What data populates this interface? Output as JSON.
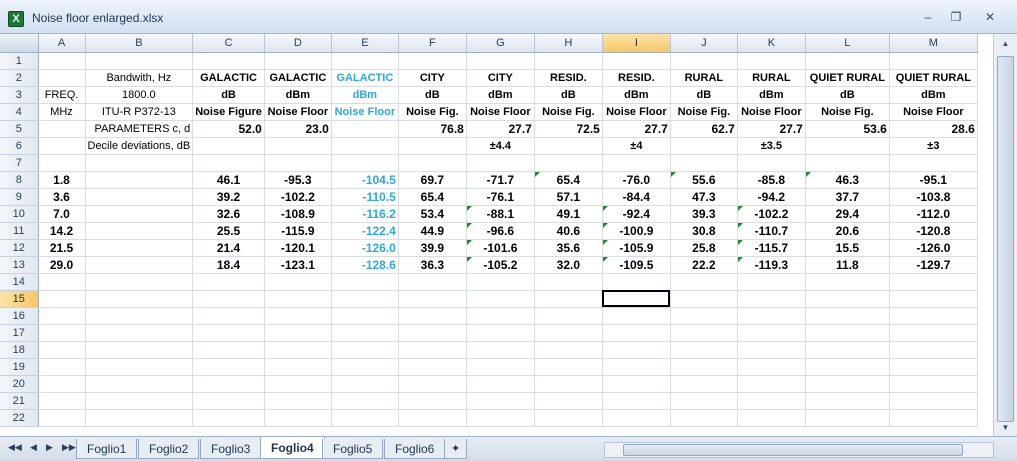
{
  "window": {
    "title": "Noise floor enlarged.xlsx"
  },
  "columns": [
    "A",
    "B",
    "C",
    "D",
    "E",
    "F",
    "G",
    "H",
    "I",
    "J",
    "K",
    "L",
    "M"
  ],
  "selected_column": "I",
  "selected_row": "15",
  "active_cell": "I15",
  "rows": [
    {
      "n": "1",
      "cells": {}
    },
    {
      "n": "2",
      "cells": {
        "B": "Bandwith, Hz",
        "C": "GALACTIC",
        "D": "GALACTIC",
        "E": "GALACTIC",
        "F": "CITY",
        "G": "CITY",
        "H": "RESID.",
        "I": "RESID.",
        "J": "RURAL",
        "K": "RURAL",
        "L": "QUIET RURAL",
        "M": "QUIET RURAL"
      }
    },
    {
      "n": "3",
      "cells": {
        "A": "FREQ.",
        "B": "1800.0",
        "C": "dB",
        "D": "dBm",
        "E": "dBm",
        "F": "dB",
        "G": "dBm",
        "H": "dB",
        "I": "dBm",
        "J": "dB",
        "K": "dBm",
        "L": "dB",
        "M": "dBm"
      }
    },
    {
      "n": "4",
      "cells": {
        "A": "MHz",
        "B": "ITU-R P372-13",
        "C": "Noise Figure",
        "D": "Noise Floor",
        "E": "Noise Floor",
        "F": "Noise Fig.",
        "G": "Noise Floor",
        "H": "Noise Fig.",
        "I": "Noise Floor",
        "J": "Noise Fig.",
        "K": "Noise Floor",
        "L": "Noise Fig.",
        "M": "Noise Floor"
      }
    },
    {
      "n": "5",
      "cells": {
        "B": "PARAMETERS c, d",
        "C": "52.0",
        "D": "23.0",
        "F": "76.8",
        "G": "27.7",
        "H": "72.5",
        "I": "27.7",
        "J": "62.7",
        "K": "27.7",
        "L": "53.6",
        "M": "28.6"
      }
    },
    {
      "n": "6",
      "cells": {
        "B": "Decile deviations, dB",
        "G": "±4.4",
        "I": "±4",
        "K": "±3.5",
        "M": "±3"
      }
    },
    {
      "n": "7",
      "cells": {}
    },
    {
      "n": "8",
      "cells": {
        "A": "1.8",
        "C": "46.1",
        "D": "-95.3",
        "E": "-104.5",
        "F": "69.7",
        "G": "-71.7",
        "H": "65.4",
        "I": "-76.0",
        "J": "55.6",
        "K": "-85.8",
        "L": "46.3",
        "M": "-95.1"
      }
    },
    {
      "n": "9",
      "cells": {
        "A": "3.6",
        "C": "39.2",
        "D": "-102.2",
        "E": "-110.5",
        "F": "65.4",
        "G": "-76.1",
        "H": "57.1",
        "I": "-84.4",
        "J": "47.3",
        "K": "-94.2",
        "L": "37.7",
        "M": "-103.8"
      }
    },
    {
      "n": "10",
      "cells": {
        "A": "7.0",
        "C": "32.6",
        "D": "-108.9",
        "E": "-116.2",
        "F": "53.4",
        "G": "-88.1",
        "H": "49.1",
        "I": "-92.4",
        "J": "39.3",
        "K": "-102.2",
        "L": "29.4",
        "M": "-112.0"
      }
    },
    {
      "n": "11",
      "cells": {
        "A": "14.2",
        "C": "25.5",
        "D": "-115.9",
        "E": "-122.4",
        "F": "44.9",
        "G": "-96.6",
        "H": "40.6",
        "I": "-100.9",
        "J": "30.8",
        "K": "-110.7",
        "L": "20.6",
        "M": "-120.8"
      }
    },
    {
      "n": "12",
      "cells": {
        "A": "21.5",
        "C": "21.4",
        "D": "-120.1",
        "E": "-126.0",
        "F": "39.9",
        "G": "-101.6",
        "H": "35.6",
        "I": "-105.9",
        "J": "25.8",
        "K": "-115.7",
        "L": "15.5",
        "M": "-126.0"
      }
    },
    {
      "n": "13",
      "cells": {
        "A": "29.0",
        "C": "18.4",
        "D": "-123.1",
        "E": "-128.6",
        "F": "36.3",
        "G": "-105.2",
        "H": "32.0",
        "I": "-109.5",
        "J": "22.2",
        "K": "-119.3",
        "L": "11.8",
        "M": "-129.7"
      }
    },
    {
      "n": "14",
      "cells": {}
    },
    {
      "n": "15",
      "cells": {}
    },
    {
      "n": "16",
      "cells": {}
    },
    {
      "n": "17",
      "cells": {}
    },
    {
      "n": "18",
      "cells": {}
    },
    {
      "n": "19",
      "cells": {}
    },
    {
      "n": "20",
      "cells": {}
    },
    {
      "n": "21",
      "cells": {}
    },
    {
      "n": "22",
      "cells": {}
    }
  ],
  "sheet_tabs": [
    "Foglio1",
    "Foglio2",
    "Foglio3",
    "Foglio4",
    "Foglio5",
    "Foglio6"
  ],
  "active_tab": "Foglio4",
  "colors": {
    "cyan_column": "#2fa8d6",
    "comment_marker": "#1f8a2d",
    "selected_header": "#f6c765"
  }
}
